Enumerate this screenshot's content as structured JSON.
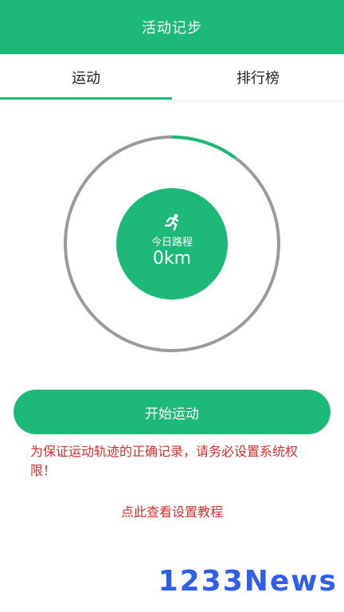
{
  "header": {
    "title": "活动记步"
  },
  "tabs": [
    {
      "label": "运动",
      "active": true
    },
    {
      "label": "排行榜",
      "active": false
    }
  ],
  "progress": {
    "fraction": 0.1,
    "colors": {
      "track": "#9a9a9a",
      "fill": "#1cb978"
    }
  },
  "stats": {
    "label": "今日路程",
    "value": "0km",
    "icon": "running-person-icon"
  },
  "actions": {
    "start_label": "开始运动",
    "tutorial_link": "点此查看设置教程"
  },
  "notice": {
    "text": "为保证运动轨迹的正确记录，请务必设置系统权限！"
  },
  "watermark": {
    "text": "1233News"
  },
  "colors": {
    "accent": "#1cb978",
    "warning": "#d9302c",
    "watermark": "#2f5fe8"
  }
}
